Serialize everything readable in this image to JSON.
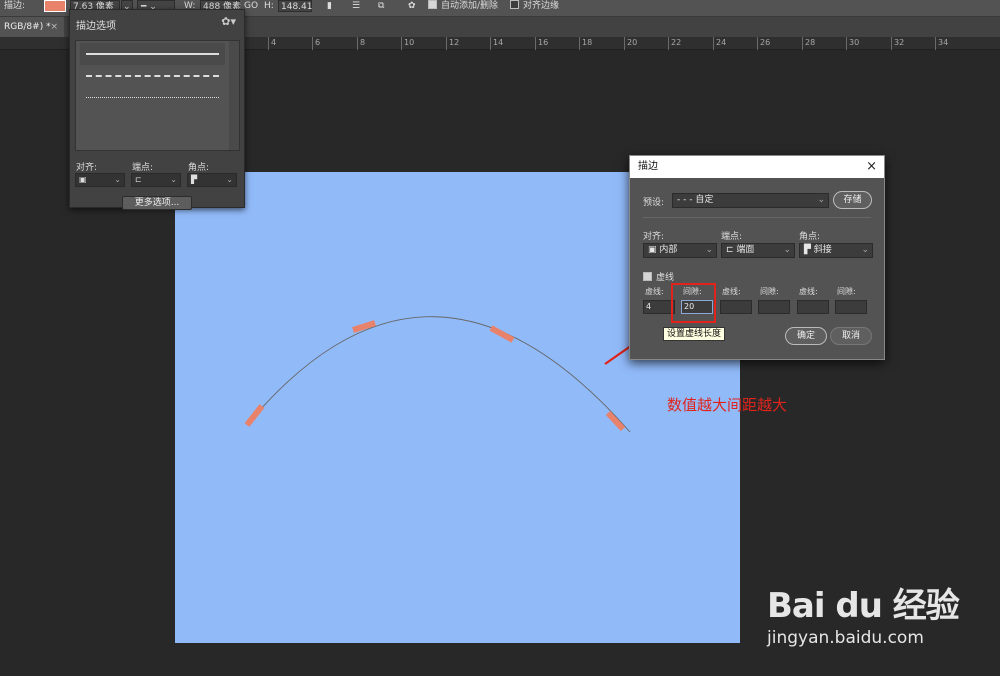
{
  "options_bar": {
    "stroke_label": "描边:",
    "stroke_width": "7.63 像素",
    "w_label": "W:",
    "w_value": "488 像素",
    "go_label": "GO",
    "h_label": "H:",
    "h_value": "148.41",
    "auto_add_delete_label": "自动添加/删除",
    "align_edges_label": "对齐边缘",
    "colors": {
      "stroke": "#e8826b"
    }
  },
  "document_tab": {
    "label": "RGB/8#) *",
    "close": "×"
  },
  "ruler": {
    "ticks": [
      "4",
      "6",
      "8",
      "10",
      "12",
      "14",
      "16",
      "18",
      "20",
      "22",
      "24",
      "26",
      "28",
      "30",
      "32",
      "34"
    ]
  },
  "stroke_panel": {
    "title": "描边选项",
    "presets": [
      "solid",
      "dashed",
      "dotted"
    ],
    "align_label": "对齐:",
    "cap_label": "端点:",
    "corner_label": "角点:",
    "more_options": "更多选项..."
  },
  "dialog": {
    "title": "描边",
    "close": "×",
    "preset_label": "预设:",
    "preset_value": "- - - 自定",
    "save_button": "存储",
    "align_label": "对齐:",
    "align_value": "内部",
    "cap_label": "端点:",
    "cap_value": "端面",
    "corner_label": "角点:",
    "corner_value": "斜接",
    "dashed_label": "虚线",
    "dashed_checked": true,
    "dash_labels": [
      "虚线:",
      "间隙:",
      "虚线:",
      "间隙:",
      "虚线:",
      "间隙:"
    ],
    "dash_values": [
      "4",
      "20",
      "",
      "",
      "",
      ""
    ],
    "ok_button": "确定",
    "cancel_button": "取消"
  },
  "tooltip": "设置虚线长度",
  "annotation": "数值越大间距越大",
  "watermark": {
    "logo": "Bai du 经验",
    "url": "jingyan.baidu.com"
  },
  "canvas": {
    "background": "#91baf9",
    "dash_color": "#e8826b"
  }
}
